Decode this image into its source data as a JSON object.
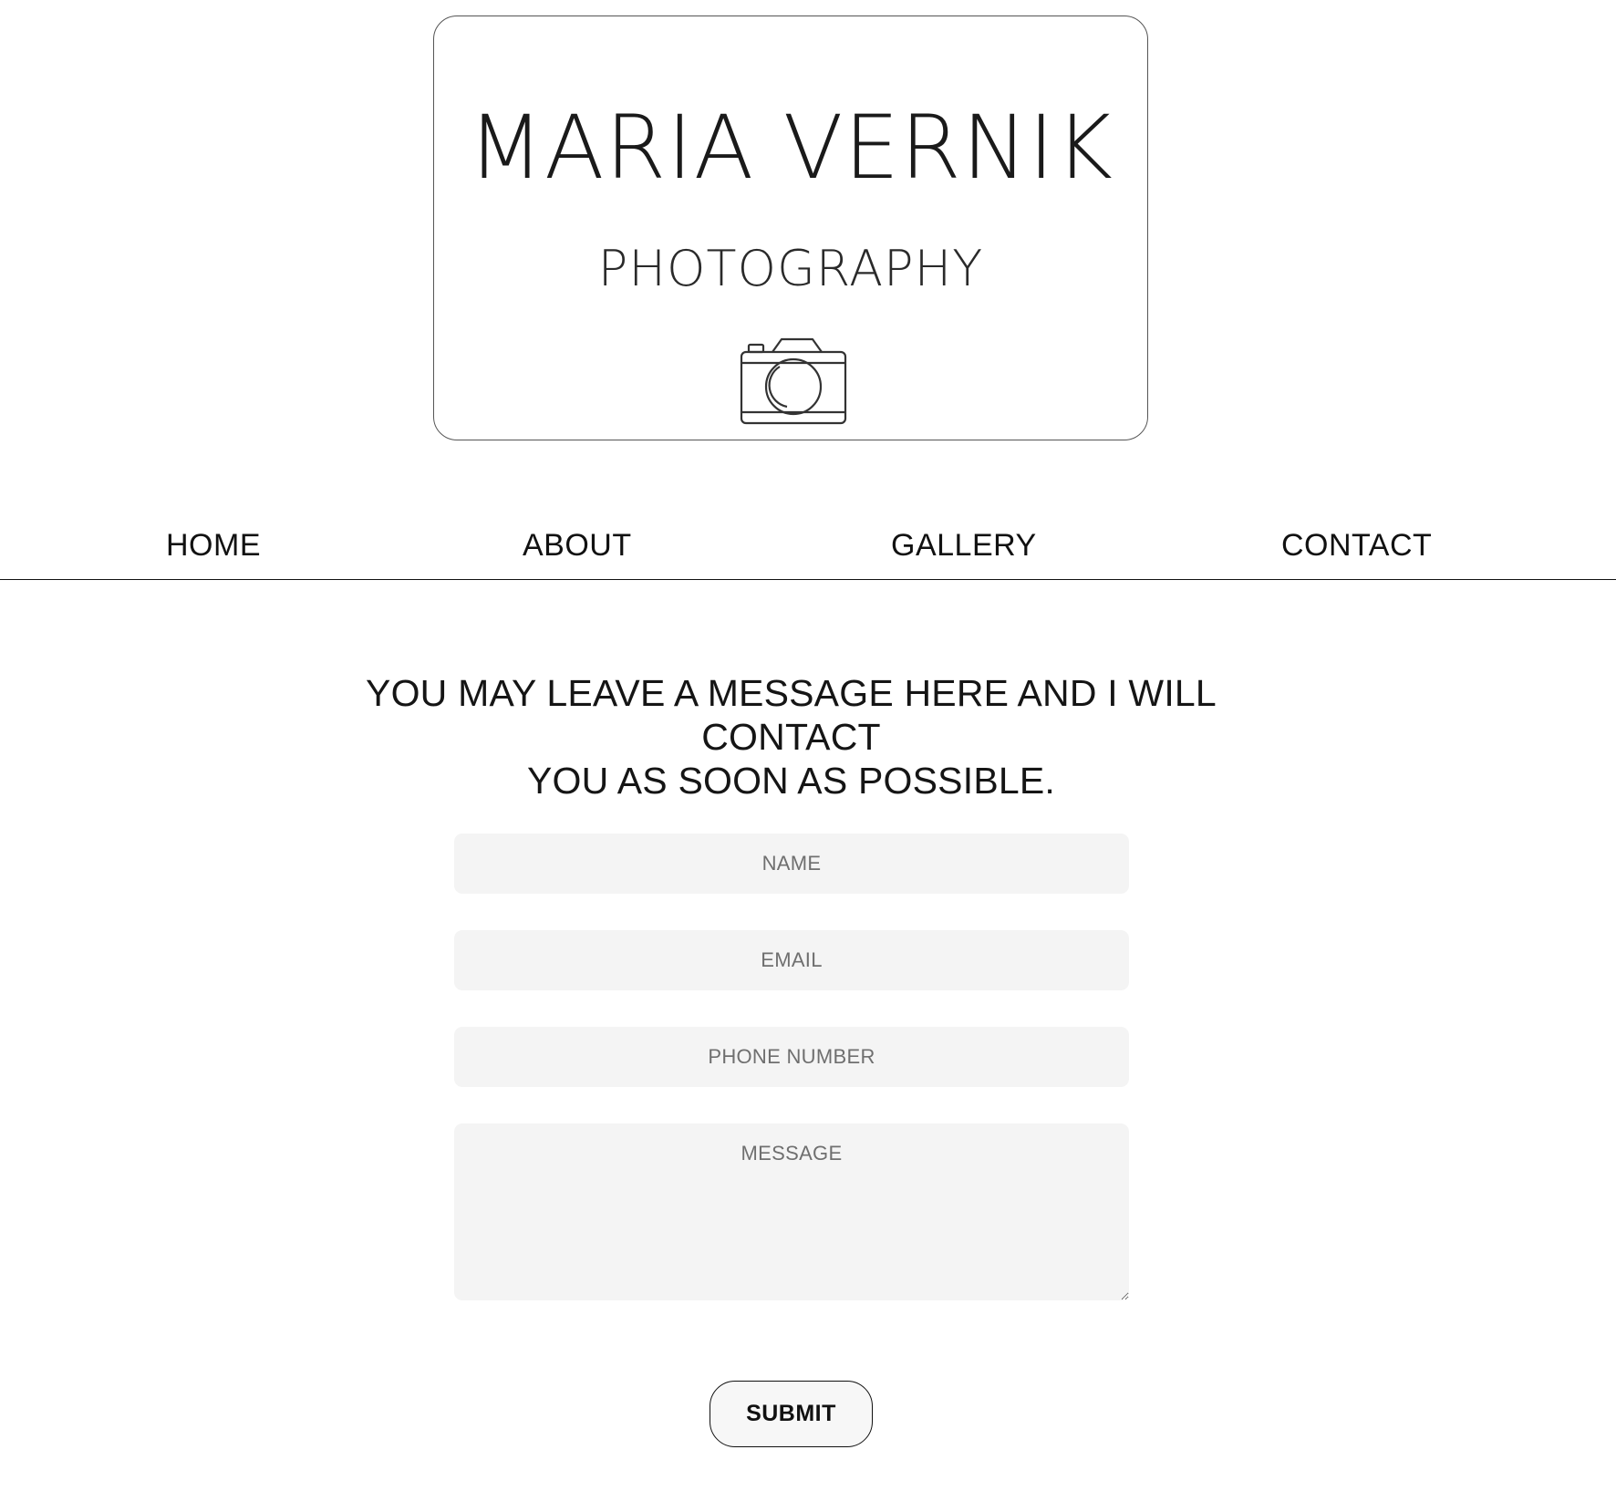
{
  "logo": {
    "name": "MARIA VERNIK",
    "subtitle": "PHOTOGRAPHY",
    "icon": "camera-icon"
  },
  "nav": {
    "items": [
      {
        "label": "HOME"
      },
      {
        "label": "ABOUT"
      },
      {
        "label": "GALLERY"
      },
      {
        "label": "CONTACT"
      }
    ]
  },
  "intro": {
    "line1": "YOU MAY LEAVE A MESSAGE HERE AND I WILL CONTACT",
    "line2": "YOU AS SOON AS POSSIBLE."
  },
  "form": {
    "name_placeholder": "NAME",
    "email_placeholder": "EMAIL",
    "phone_placeholder": "PHONE NUMBER",
    "message_placeholder": "MESSAGE",
    "submit_label": "SUBMIT"
  },
  "colors": {
    "background": "#ffffff",
    "text": "#111111",
    "field_background": "#f4f4f4",
    "placeholder": "#6f6f6f"
  }
}
